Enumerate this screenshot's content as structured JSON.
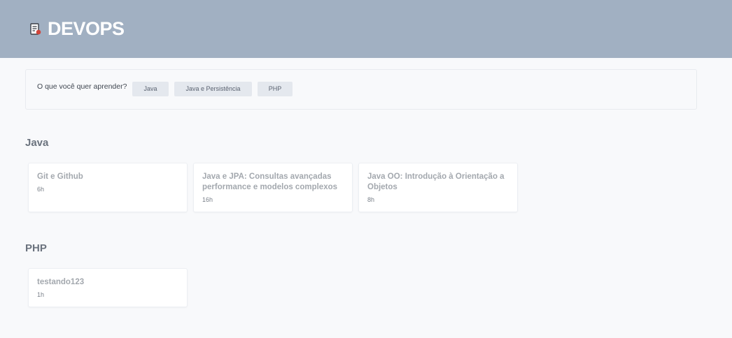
{
  "header": {
    "brand": "DEVOPS",
    "logo_icon": "document-icon"
  },
  "filter": {
    "label": "O que você quer aprender?",
    "chips": [
      {
        "label": "Java"
      },
      {
        "label": "Java e Persistência"
      },
      {
        "label": "PHP"
      }
    ]
  },
  "sections": [
    {
      "title": "Java",
      "courses": [
        {
          "title": "Git e Github",
          "duration": "6h"
        },
        {
          "title": "Java e JPA: Consultas avançadas performance e modelos complexos",
          "duration": "16h"
        },
        {
          "title": "Java OO: Introdução à Orientação a Objetos",
          "duration": "8h"
        }
      ]
    },
    {
      "title": "PHP",
      "courses": [
        {
          "title": "testando123",
          "duration": "1h"
        }
      ]
    }
  ],
  "colors": {
    "header_bg": "#a1b0c2",
    "page_bg": "#f8f9fb",
    "chip_bg": "#e4e8ee"
  }
}
